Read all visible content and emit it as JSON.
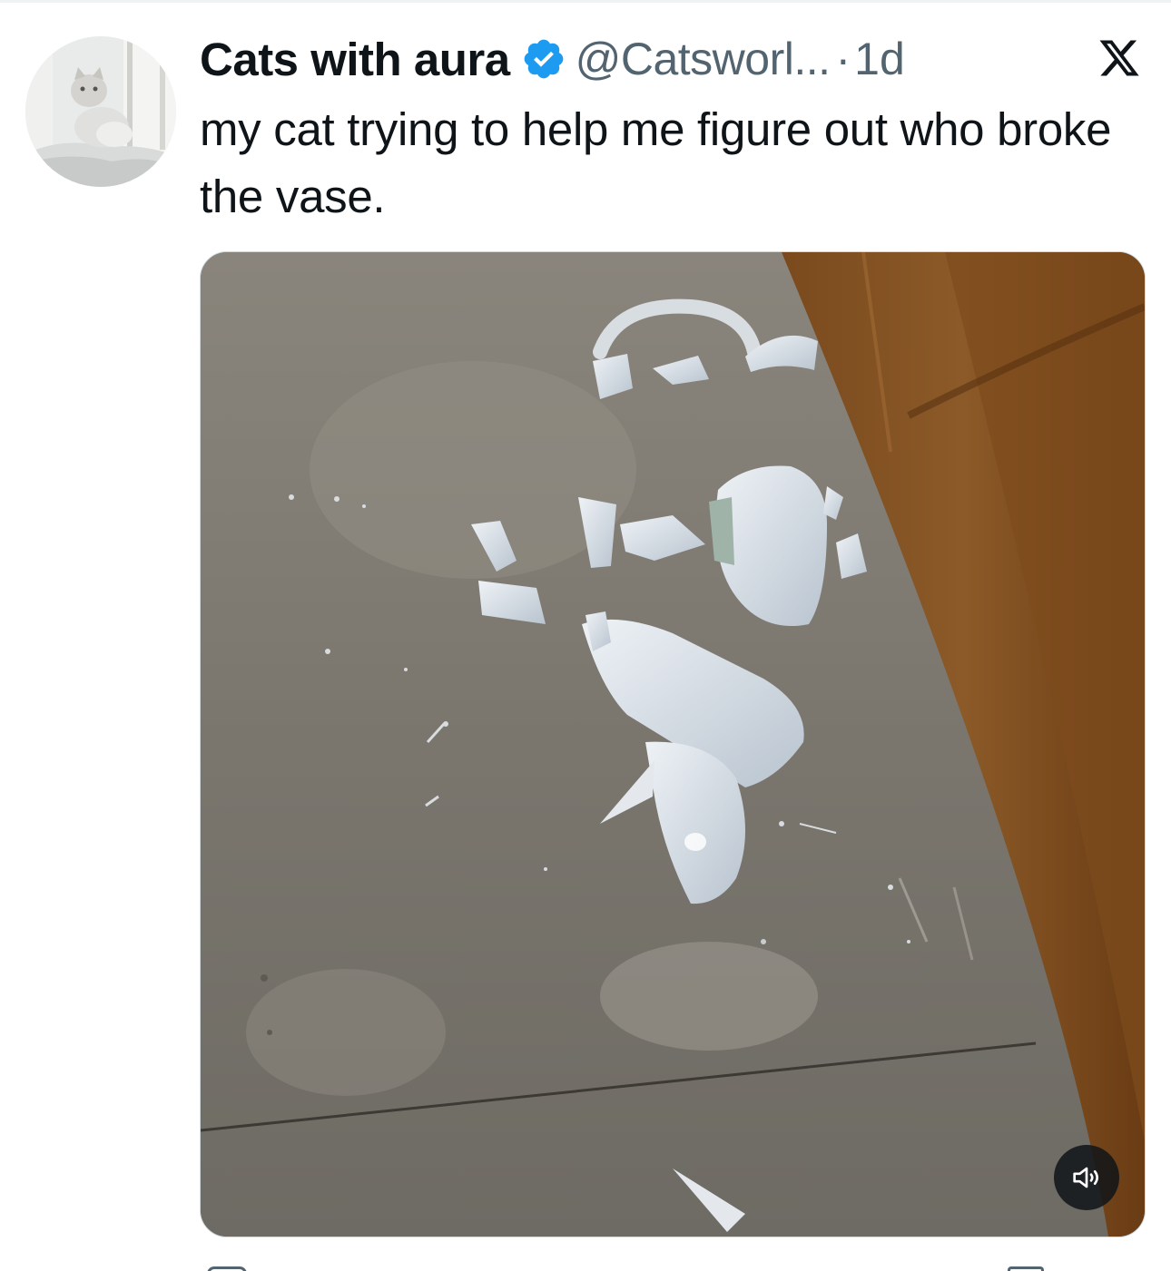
{
  "post": {
    "display_name": "Cats with aura",
    "handle": "@Catsworl...",
    "separator": "·",
    "time": "1d",
    "text": "my cat trying to help me figure out who broke the vase.",
    "verified": true
  },
  "icons": {
    "verified": "verified-badge-icon",
    "platform": "x-logo-icon",
    "mute": "speaker-icon"
  },
  "colors": {
    "text_primary": "#0f1419",
    "text_secondary": "#536471",
    "verified_blue": "#1d9bf0",
    "mute_button_bg": "#0f1419"
  }
}
